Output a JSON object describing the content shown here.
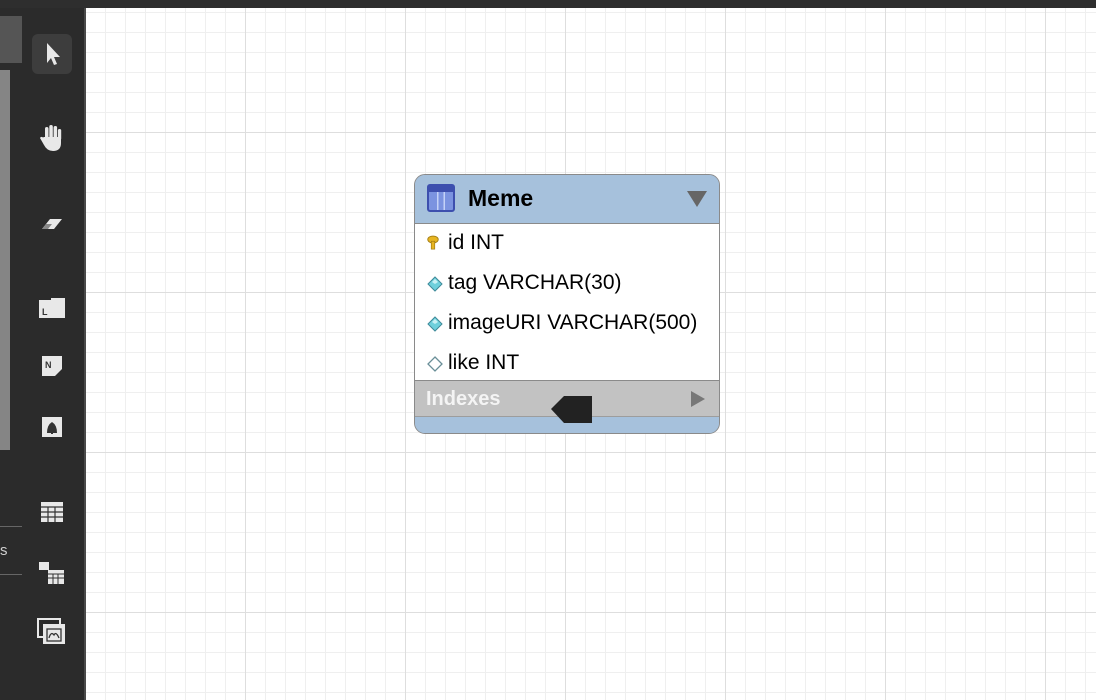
{
  "entity": {
    "name": "Meme",
    "columns": [
      {
        "text": "id INT",
        "icon": "primary-key-icon"
      },
      {
        "text": "tag VARCHAR(30)",
        "icon": "column-filled-diamond-icon"
      },
      {
        "text": "imageURI VARCHAR(500)",
        "icon": "column-filled-diamond-icon"
      },
      {
        "text": "like INT",
        "icon": "column-empty-diamond-icon"
      }
    ],
    "indexes_label": "Indexes"
  },
  "left_panel": {
    "fragment_text": "s"
  },
  "tools": [
    "pointer-tool-icon",
    "hand-tool-icon",
    "eraser-tool-icon",
    "layer-tool-icon",
    "note-tool-icon",
    "image-tool-icon",
    "table-tool-icon",
    "view-tool-icon",
    "routine-group-tool-icon"
  ],
  "colors": {
    "entity_header": "#a6c1dc",
    "indexes_band": "#c2c2c2",
    "canvas": "#ffffff",
    "toolbar": "#2b2b2b"
  }
}
